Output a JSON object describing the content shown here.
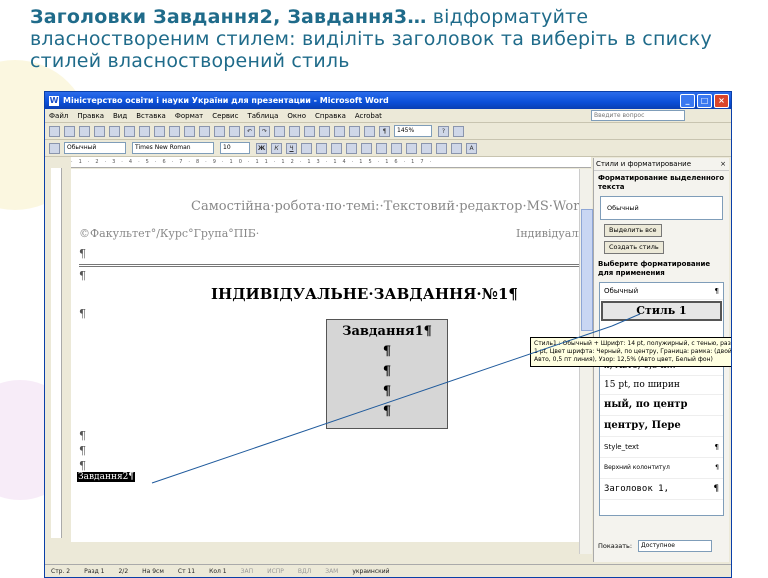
{
  "caption": {
    "bold": "Заголовки Завдання2, Завдання3…",
    "rest": " відформатуйте власноствореним стилем: виділіть заголовок та виберіть в списку стилей власностворений стиль"
  },
  "window": {
    "title": "Міністерство освіти і науки України для презентации - Microsoft Word",
    "menu": [
      "Файл",
      "Правка",
      "Вид",
      "Вставка",
      "Формат",
      "Сервис",
      "Таблица",
      "Окно",
      "Справка",
      "Acrobat"
    ],
    "help_placeholder": "Введите вопрос",
    "zoom": "145%",
    "style_combo": "Обычный",
    "font_combo": "Times New Roman",
    "size_combo": "10"
  },
  "document": {
    "header_title": "Самостійна·робота·по·темі:·Текстовий·редактор·MS·Word",
    "header_left": "©Факультет°/Курс°Група°ПІБ·",
    "header_right": "Індивідуальне",
    "main_title": "ІНДИВІДУАЛЬНЕ·ЗАВДАННЯ·№1¶",
    "box_title": "Завдання1¶",
    "box_marks": [
      "¶",
      "¶",
      "¶",
      "¶"
    ],
    "selected_text": "Завдання2¶",
    "pilcrow": "¶"
  },
  "status": [
    "Стр. 2",
    "Разд 1",
    "2/2",
    "На 9см",
    "Ст 11",
    "Кол 1",
    "ЗАП",
    "ИСПР",
    "ВДЛ",
    "ЗАМ",
    "украинский"
  ],
  "pane": {
    "title": "Стили и форматирование",
    "sec_current": "Форматирование выделенного текста",
    "current_style": "Обычный",
    "btn_select_all": "Выделить все",
    "btn_new_style": "Создать стиль",
    "sec_apply": "Выберите форматирование для применения",
    "list": [
      "Обычный",
      "Стиль 1",
      "",
      "я, Авто, 0,5 п…",
      "15 pt, по ширин",
      "ный, по центр",
      "центру, Пере",
      "Style_text",
      "Верхний колонтитул",
      "Заголовок 1,"
    ],
    "show_label": "Показать:",
    "show_value": "Доступное"
  },
  "tooltip": "Стиль1 : Обычный + Шрифт: 14 pt, полужирный, с тенью, разреженный на 1 pt, Цвет шрифта: Черный, по центру, Граница: рамка: (двойная линия, Авто, 0,5 пт линия), Узор: 12,5% (Авто цвет, Белый фон)"
}
